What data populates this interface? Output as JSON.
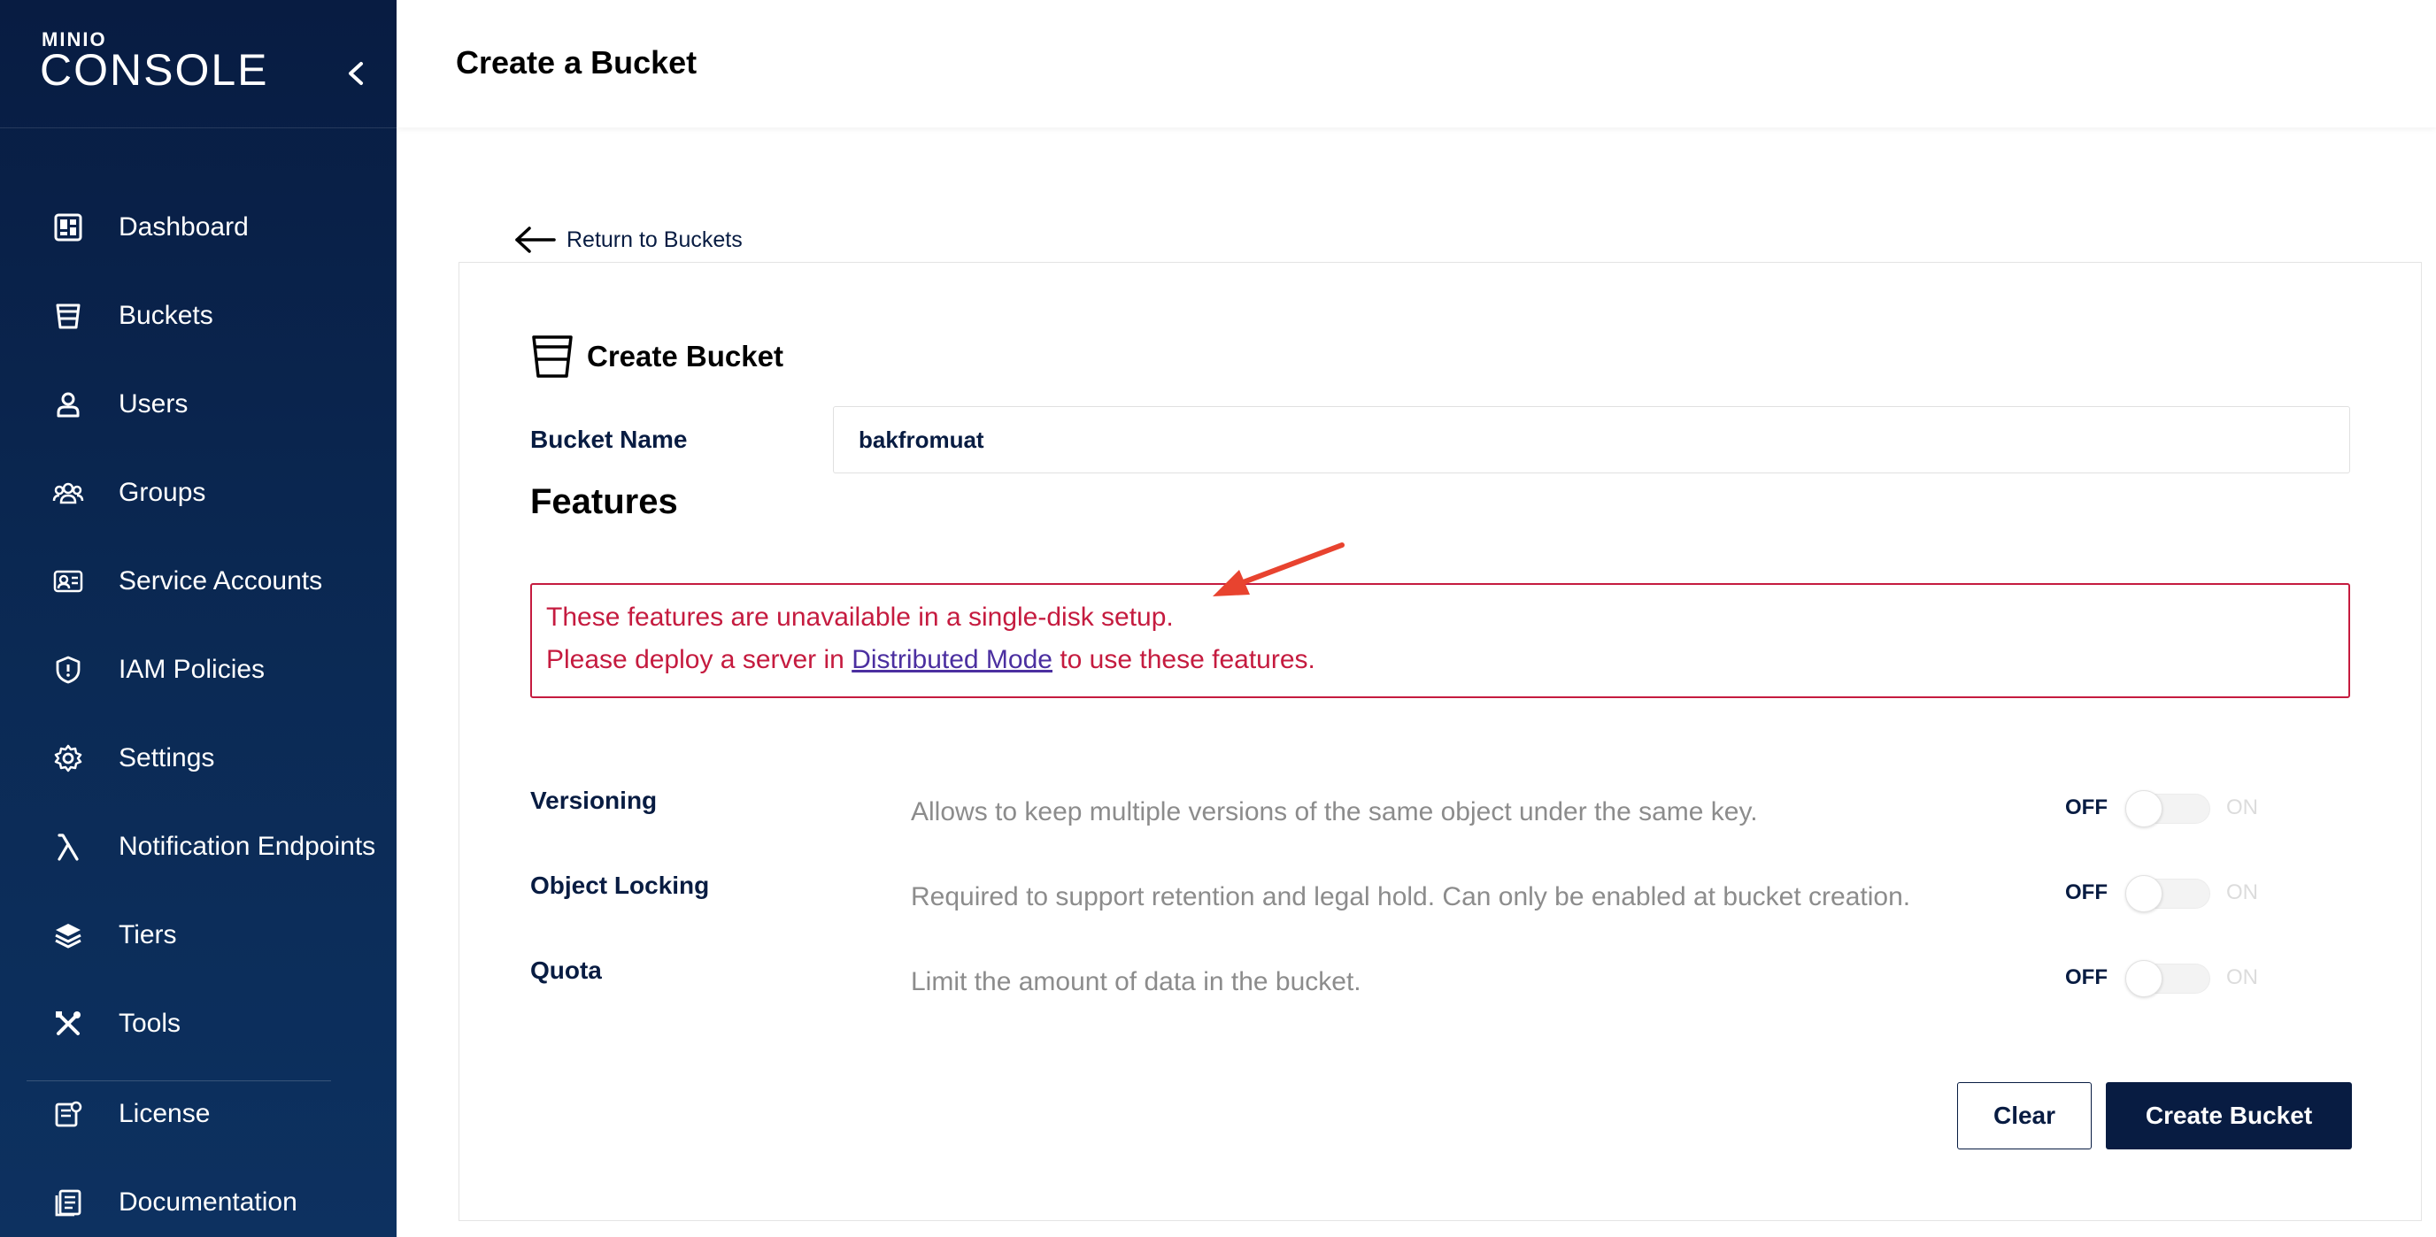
{
  "brand": {
    "mini": "MINIO",
    "name": "CONSOLE"
  },
  "sidebar": {
    "items": [
      {
        "label": "Dashboard",
        "icon": "dashboard-icon"
      },
      {
        "label": "Buckets",
        "icon": "bucket-icon"
      },
      {
        "label": "Users",
        "icon": "user-icon"
      },
      {
        "label": "Groups",
        "icon": "groups-icon"
      },
      {
        "label": "Service Accounts",
        "icon": "service-account-icon"
      },
      {
        "label": "IAM Policies",
        "icon": "shield-icon"
      },
      {
        "label": "Settings",
        "icon": "gear-icon"
      },
      {
        "label": "Notification Endpoints",
        "icon": "lambda-icon"
      },
      {
        "label": "Tiers",
        "icon": "layers-icon"
      },
      {
        "label": "Tools",
        "icon": "tools-icon"
      },
      {
        "label": "License",
        "icon": "license-icon"
      },
      {
        "label": "Documentation",
        "icon": "documentation-icon"
      }
    ]
  },
  "header": {
    "title": "Create a Bucket"
  },
  "back_link": {
    "label": "Return to Buckets"
  },
  "card": {
    "title": "Create Bucket",
    "bucket_name_label": "Bucket Name",
    "bucket_name_value": "bakfromuat",
    "features_heading": "Features",
    "alert": {
      "line1": "These features are unavailable in a single-disk setup.",
      "line2_prefix": "Please deploy a server in",
      "line2_link": "Distributed Mode",
      "line2_suffix": "to use these features."
    },
    "features": [
      {
        "name": "Versioning",
        "description": "Allows to keep multiple versions of the same object under the same key.",
        "off_label": "OFF",
        "on_label": "ON",
        "enabled": false
      },
      {
        "name": "Object Locking",
        "description": "Required to support retention and legal hold. Can only be enabled at bucket creation.",
        "off_label": "OFF",
        "on_label": "ON",
        "enabled": false
      },
      {
        "name": "Quota",
        "description": "Limit the amount of data in the bucket.",
        "off_label": "OFF",
        "on_label": "ON",
        "enabled": false
      }
    ],
    "buttons": {
      "clear": "Clear",
      "create": "Create Bucket"
    }
  },
  "colors": {
    "sidebar_bg": "#081c42",
    "accent": "#081c42",
    "alert": "#c51b3f",
    "link": "#4b2fa0",
    "annotation_arrow": "#e8432f"
  }
}
